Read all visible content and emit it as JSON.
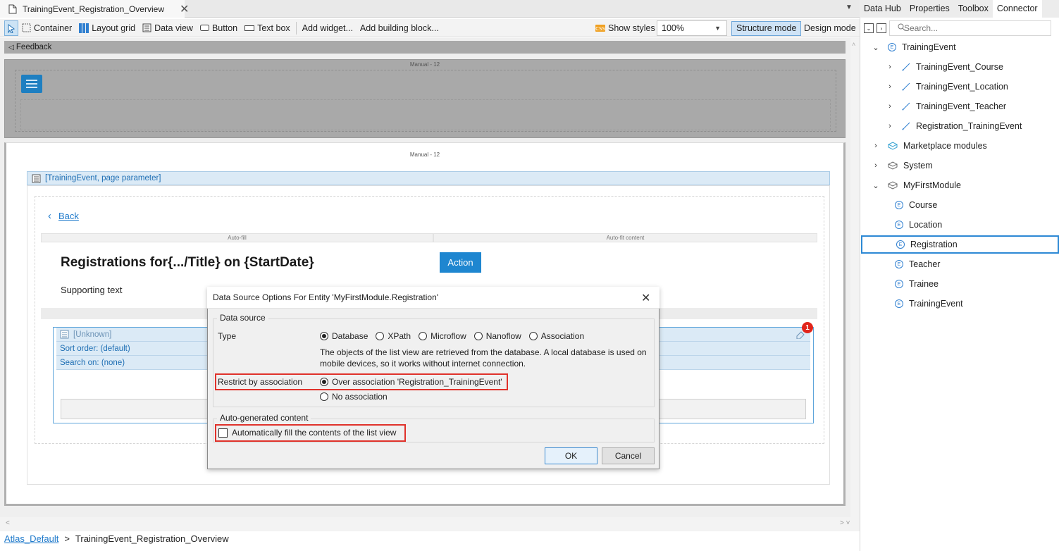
{
  "tab": {
    "title": "TrainingEvent_Registration_Overview",
    "close": "✕",
    "dropdown": "▼"
  },
  "toolbar": {
    "items": [
      "Container",
      "Layout grid",
      "Data view",
      "Button",
      "Text box"
    ],
    "add_widget": "Add widget...",
    "add_block": "Add building block...",
    "show_styles": "Show styles",
    "zoom": "100%",
    "structure_mode": "Structure mode",
    "design_mode": "Design mode"
  },
  "canvas": {
    "feedback": "Feedback",
    "manual_label": "Manual - 12",
    "manual_label_2": "Manual - 12",
    "dataview_header": "[TrainingEvent, page parameter]",
    "back": "Back",
    "col_autofill": "Auto-fill",
    "col_autofit": "Auto-fit content",
    "heading": "Registrations for{.../Title} on {StartDate}",
    "supporting_text": "Supporting text",
    "action_button": "Action",
    "listview": {
      "unknown": "[Unknown]",
      "sort_order": "Sort order: (default)",
      "search_on": "Search on: (none)",
      "badge": "1"
    }
  },
  "dialog": {
    "title": "Data Source Options For Entity 'MyFirstModule.Registration'",
    "close": "✕",
    "data_source_group": "Data source",
    "type_label": "Type",
    "type_options": [
      {
        "label": "Database",
        "checked": true
      },
      {
        "label": "XPath",
        "checked": false
      },
      {
        "label": "Microflow",
        "checked": false
      },
      {
        "label": "Nanoflow",
        "checked": false
      },
      {
        "label": "Association",
        "checked": false
      }
    ],
    "description": "The objects of the list view are retrieved from the database. A local database is used on mobile devices, so it works without internet connection.",
    "restrict_label": "Restrict by association",
    "restrict_option1": "Over association 'Registration_TrainingEvent'",
    "restrict_option2": "No association",
    "auto_group": "Auto-generated content",
    "autofill_label": "Automatically fill the contents of the list view",
    "ok": "OK",
    "cancel": "Cancel",
    "highlight_color": "#e0322b"
  },
  "breadcrumb": {
    "root": "Atlas_Default",
    "sep": ">",
    "page": "TrainingEvent_Registration_Overview"
  },
  "panel": {
    "tabs": [
      "Data Hub",
      "Properties",
      "Toolbox",
      "Connector"
    ],
    "active_tab": "Connector",
    "search_placeholder": "Search...",
    "tree": [
      {
        "label": "TrainingEvent",
        "indent": 0,
        "chev": "⌄",
        "icon": "entity"
      },
      {
        "label": "TrainingEvent_Course",
        "indent": 1,
        "chev": "›",
        "icon": "assoc"
      },
      {
        "label": "TrainingEvent_Location",
        "indent": 1,
        "chev": "›",
        "icon": "assoc"
      },
      {
        "label": "TrainingEvent_Teacher",
        "indent": 1,
        "chev": "›",
        "icon": "assoc"
      },
      {
        "label": "Registration_TrainingEvent",
        "indent": 1,
        "chev": "›",
        "icon": "assoc"
      },
      {
        "label": "Marketplace modules",
        "indent": 0,
        "chev": "›",
        "icon": "module-blue"
      },
      {
        "label": "System",
        "indent": 0,
        "chev": "›",
        "icon": "module"
      },
      {
        "label": "MyFirstModule",
        "indent": 0,
        "chev": "⌄",
        "icon": "module"
      },
      {
        "label": "Course",
        "indent": 2,
        "chev": "",
        "icon": "entity"
      },
      {
        "label": "Location",
        "indent": 2,
        "chev": "",
        "icon": "entity"
      },
      {
        "label": "Registration",
        "indent": 2,
        "chev": "",
        "icon": "entity",
        "selected": true
      },
      {
        "label": "Teacher",
        "indent": 2,
        "chev": "",
        "icon": "entity"
      },
      {
        "label": "Trainee",
        "indent": 2,
        "chev": "",
        "icon": "entity"
      },
      {
        "label": "TrainingEvent",
        "indent": 2,
        "chev": "",
        "icon": "entity"
      }
    ]
  }
}
